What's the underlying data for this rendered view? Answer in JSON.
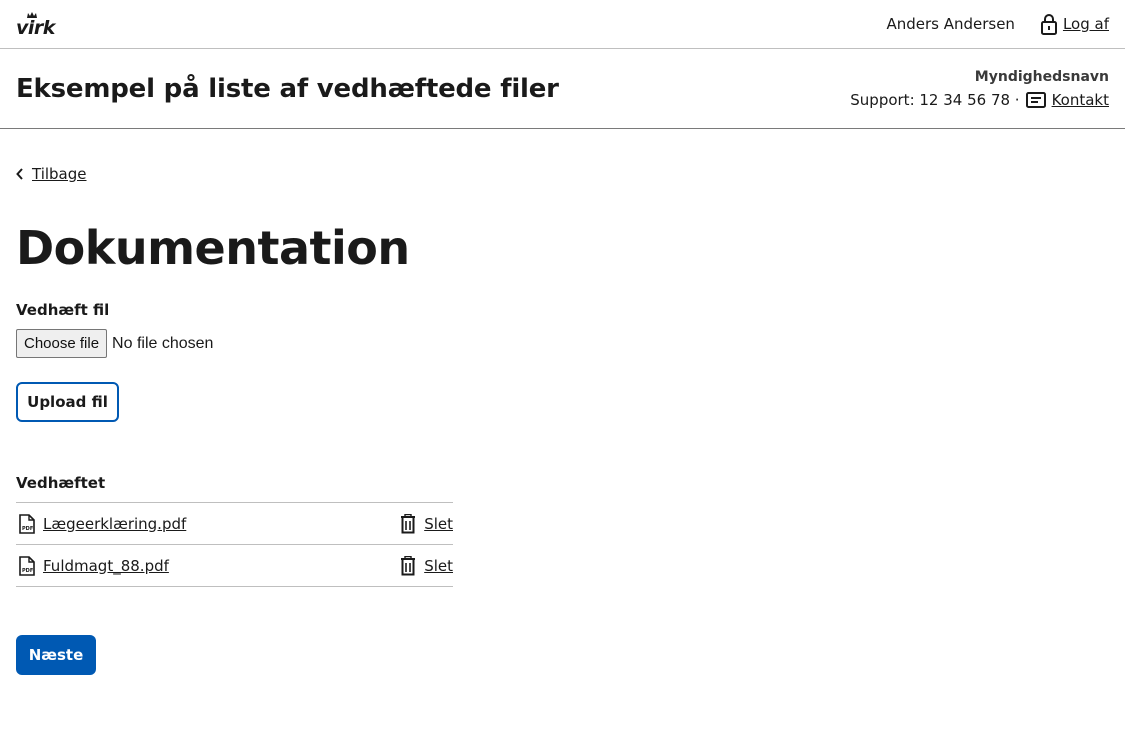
{
  "topbar": {
    "logo_text": "virk",
    "user_name": "Anders Andersen",
    "logout_label": "Log af"
  },
  "header": {
    "title": "Eksempel på liste af vedhæftede filer",
    "authority_name": "Myndighedsnavn",
    "support_text": "Support: 12 34 56 78 ·",
    "contact_label": "Kontakt"
  },
  "main": {
    "back_label": "Tilbage",
    "page_title": "Dokumentation",
    "attach_label": "Vedhæft fil",
    "choose_file_label": "Choose file",
    "no_file_text": "No file chosen",
    "upload_label": "Upload fil",
    "attached_heading": "Vedhæftet",
    "files": [
      {
        "name": "Lægeerklæring.pdf",
        "delete_label": "Slet",
        "icon": "pdf-file-icon"
      },
      {
        "name": "Fuldmagt_88.pdf",
        "delete_label": "Slet",
        "icon": "pdf-file-icon"
      }
    ],
    "next_label": "Næste"
  },
  "colors": {
    "primary": "#0059b3",
    "border": "#bfbfbf"
  }
}
